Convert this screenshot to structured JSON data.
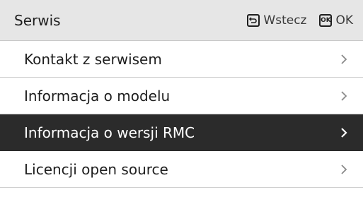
{
  "header": {
    "title": "Serwis",
    "back_label": "Wstecz",
    "back_icon": "back-arrow-icon",
    "ok_key_text": "OK",
    "ok_label": "OK"
  },
  "menu": {
    "items": [
      {
        "label": "Kontakt z serwisem",
        "selected": false
      },
      {
        "label": "Informacja o modelu",
        "selected": false
      },
      {
        "label": "Informacja o wersji RMC",
        "selected": true
      },
      {
        "label": "Licencji open source",
        "selected": false
      }
    ]
  },
  "colors": {
    "header_bg": "#e6e6e6",
    "selected_bg": "#2b2b2b",
    "text": "#1e1e1e",
    "selected_text": "#ffffff"
  }
}
